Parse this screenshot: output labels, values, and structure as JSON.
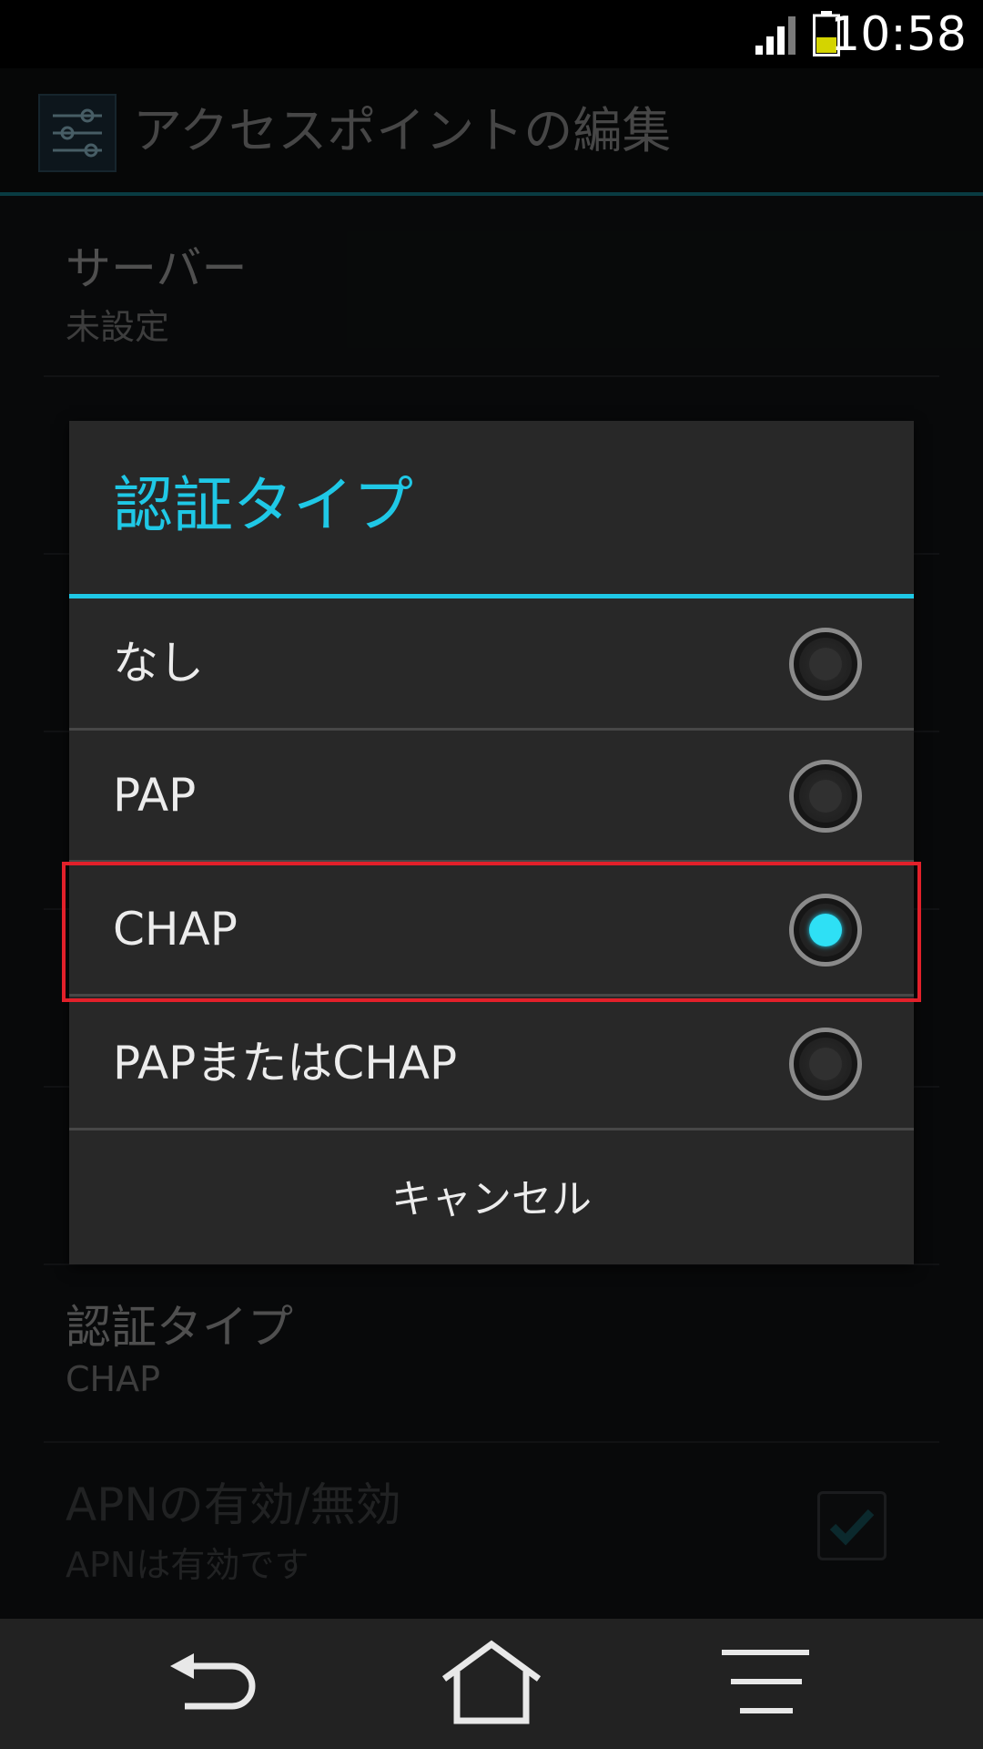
{
  "status_bar": {
    "time": "10:58",
    "icons": [
      "signal-icon",
      "battery-icon"
    ],
    "battery_level": 0.4,
    "battery_color": "#d4d400"
  },
  "action_bar": {
    "title": "アクセスポイントの編集",
    "icon": "settings-sliders-icon"
  },
  "settings": {
    "server": {
      "title": "サーバー",
      "summary": "未設定"
    },
    "auth_type": {
      "title": "認証タイプ",
      "summary": "CHAP"
    },
    "apn_enable": {
      "title": "APNの有効/無効",
      "summary": "APNは有効です",
      "checked": true
    }
  },
  "dialog": {
    "title": "認証タイプ",
    "options": [
      {
        "label": "なし",
        "selected": false
      },
      {
        "label": "PAP",
        "selected": false
      },
      {
        "label": "CHAP",
        "selected": true
      },
      {
        "label": "PAPまたはCHAP",
        "selected": false
      }
    ],
    "cancel_label": "キャンセル",
    "accent_color": "#1fc8e6"
  },
  "nav_bar": {
    "buttons": [
      "back-icon",
      "home-icon",
      "menu-icon"
    ]
  }
}
